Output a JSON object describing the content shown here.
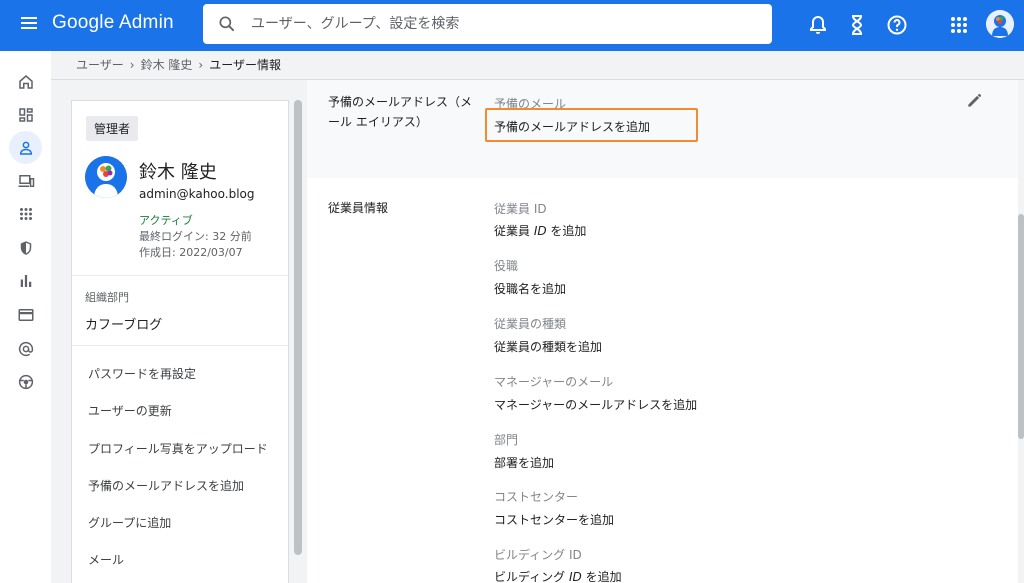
{
  "header": {
    "app_name": "Google Admin",
    "search_placeholder": "ユーザー、グループ、設定を検索"
  },
  "breadcrumb": {
    "items": [
      "ユーザー",
      "鈴木 隆史",
      "ユーザー情報"
    ]
  },
  "user": {
    "role": "管理者",
    "name": "鈴木 隆史",
    "email": "admin@kahoo.blog",
    "status": "アクティブ",
    "last_login": "最終ログイン: 32 分前",
    "created": "作成日: 2022/03/07",
    "org_label": "組織部門",
    "org_value": "カフーブログ"
  },
  "actions": [
    "パスワードを再設定",
    "ユーザーの更新",
    "プロフィール写真をアップロード",
    "予備のメールアドレスを追加",
    "グループに追加",
    "メール"
  ],
  "alt_email_section": {
    "title_line1": "予備のメールアドレス（メ",
    "title_line2": "ール エイリアス）",
    "label": "予備のメール",
    "value": "予備のメールアドレスを追加"
  },
  "employee_section": {
    "title": "従業員情報",
    "fields": [
      {
        "label": "従業員 ID",
        "value_pre": "従業員 ",
        "value_em": "ID",
        "value_post": " を追加"
      },
      {
        "label": "役職",
        "value": "役職名を追加"
      },
      {
        "label": "従業員の種類",
        "value": "従業員の種類を追加"
      },
      {
        "label": "マネージャーのメール",
        "value": "マネージャーのメールアドレスを追加"
      },
      {
        "label": "部門",
        "value": "部署を追加"
      },
      {
        "label": "コストセンター",
        "value": "コストセンターを追加"
      },
      {
        "label": "ビルディング ID",
        "value_pre": "ビルディング ",
        "value_em": "ID",
        "value_post": " を追加"
      }
    ]
  },
  "colors": {
    "brand": "#1a73e8",
    "status_active": "#188038",
    "highlight": "#f28b30"
  },
  "icons": [
    "menu-icon",
    "search-icon",
    "notifications-icon",
    "hourglass-icon",
    "help-icon",
    "apps-icon",
    "home-icon",
    "dashboard-icon",
    "user-icon",
    "devices-icon",
    "apps-grid-icon",
    "security-icon",
    "reports-icon",
    "billing-icon",
    "account-icon",
    "rules-icon",
    "edit-icon"
  ]
}
